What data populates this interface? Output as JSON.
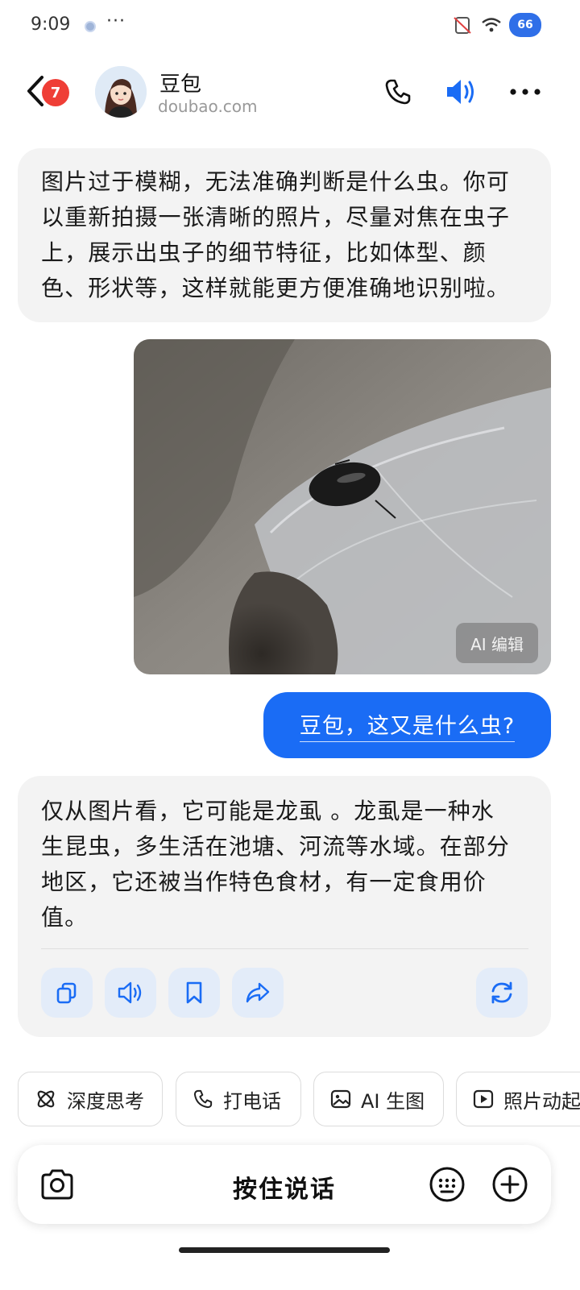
{
  "status_bar": {
    "time": "9:09",
    "more": "···",
    "cloud_badge": "66"
  },
  "header": {
    "back_badge": "7",
    "bot_name": "豆包",
    "bot_domain": "doubao.com"
  },
  "messages": [
    {
      "role": "bot",
      "lines": [
        "图片过于模糊，无法准确判断是什么虫。你可",
        "以重新拍摄一张清晰的照片，尽量对焦在虫子",
        "上，展示出虫子的细节特征，比如体型、颜",
        "色、形状等，这样就能更方便准确地识别啦。"
      ]
    },
    {
      "role": "user_image",
      "badge": "AI 编辑"
    },
    {
      "role": "user",
      "text": "豆包，这又是什么虫?"
    },
    {
      "role": "bot",
      "lines": [
        "仅从图片看，它可能是龙虱 。龙虱是一种水",
        "生昆虫，多生活在池塘、河流等水域。在部分",
        "地区，它还被当作特色食材，有一定食用价",
        "值。"
      ]
    }
  ],
  "chips": [
    {
      "label": "深度思考",
      "icon": "atom-icon"
    },
    {
      "label": "打电话",
      "icon": "phone-icon"
    },
    {
      "label": "AI 生图",
      "icon": "image-icon"
    },
    {
      "label": "照片动起来",
      "icon": "play-icon"
    }
  ],
  "input_bar": {
    "hold_to_talk": "按住说话"
  },
  "colors": {
    "accent": "#1a6cf5",
    "bubble_bg": "#f3f3f3",
    "badge_red": "#ef3e36"
  }
}
